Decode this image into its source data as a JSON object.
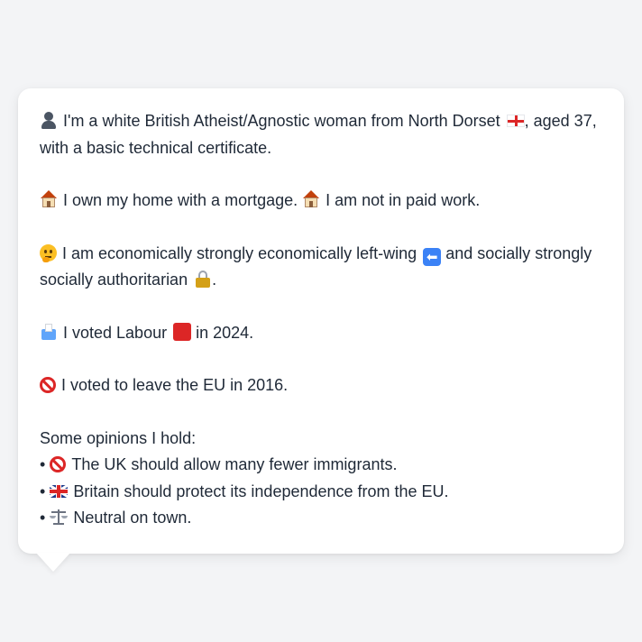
{
  "profile": {
    "intro": {
      "icon": "person-icon",
      "text_before_flag": "I'm a white British Atheist/Agnostic woman from North Dorset",
      "flag": "england-flag-icon",
      "text_after_flag": ", aged 37, with a basic technical certificate."
    },
    "home": {
      "icon": "house-icon",
      "text_a": "I own my home with a mortgage.",
      "text_b": "I am not in paid work."
    },
    "politics": {
      "icon": "thinking-face-icon",
      "text_a": "I am economically strongly economically left-wing",
      "arrow_glyph": "⬅",
      "text_b": "and socially strongly socially authoritarian",
      "text_end": "."
    },
    "vote2024": {
      "icon": "ballot-box-icon",
      "text_a": "I voted Labour",
      "party_color": "#dc2626",
      "text_b": "in 2024."
    },
    "eu": {
      "icon": "no-entry-icon",
      "text": "I voted to leave the EU in 2016."
    },
    "opinions": {
      "heading": "Some opinions I hold:",
      "bullet": "•",
      "items": [
        {
          "icon": "no-entry-icon",
          "text": "The UK should allow many fewer immigrants."
        },
        {
          "icon": "uk-flag-icon",
          "text": "Britain should protect its independence from the EU."
        },
        {
          "icon": "balance-scale-icon",
          "text": "Neutral on town."
        }
      ]
    }
  }
}
